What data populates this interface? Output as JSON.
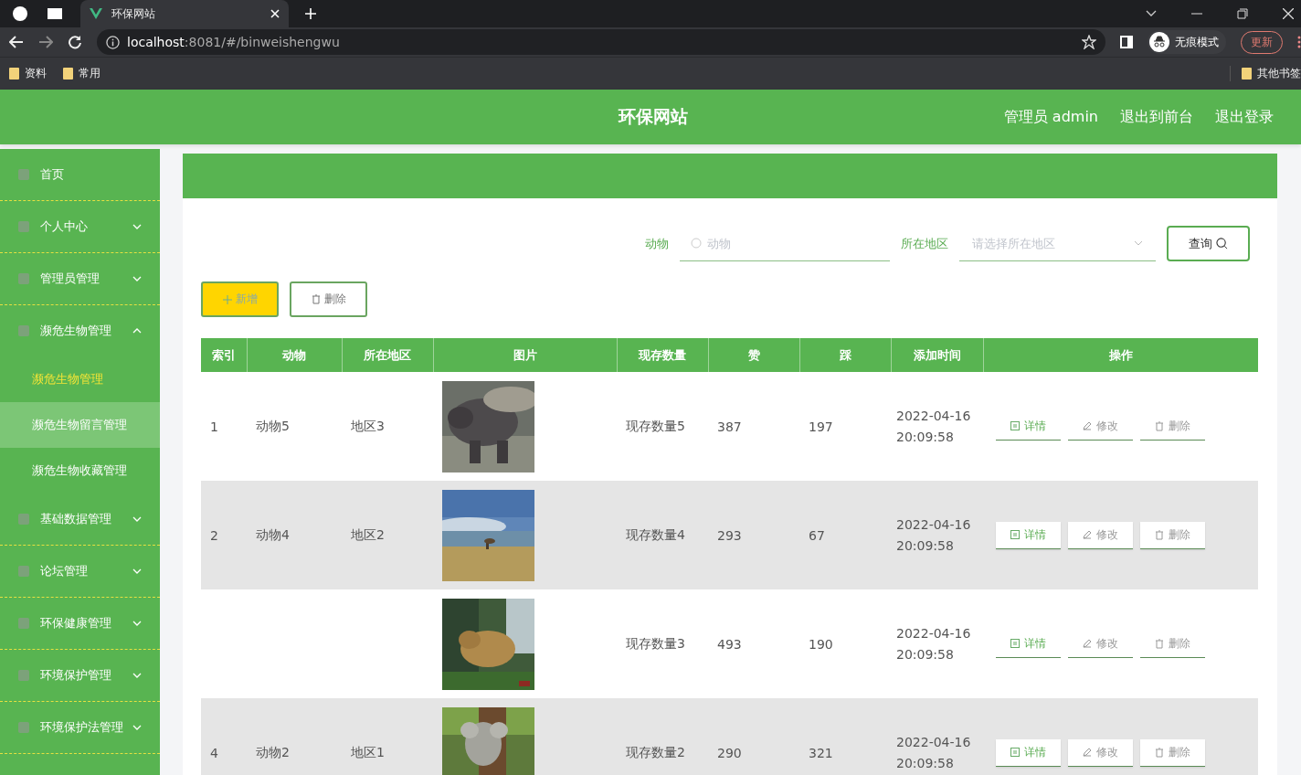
{
  "browser": {
    "tab_title": "环保网站",
    "url_host": "localhost",
    "url_rest": ":8081/#/binweishengwu",
    "incognito_label": "无痕模式",
    "update_button": "更新",
    "bookmarks": [
      "资料",
      "常用"
    ],
    "other_bookmarks": "其他书签"
  },
  "header": {
    "title": "环保网站",
    "links": [
      "管理员 admin",
      "退出到前台",
      "退出登录"
    ]
  },
  "sidebar": {
    "items": [
      {
        "label": "首页"
      },
      {
        "label": "个人中心",
        "expanded": false
      },
      {
        "label": "管理员管理",
        "expanded": false
      },
      {
        "label": "濒危生物管理",
        "expanded": true,
        "children": [
          {
            "label": "濒危生物管理",
            "selected": true,
            "hovered": false
          },
          {
            "label": "濒危生物留言管理",
            "selected": false,
            "hovered": true
          },
          {
            "label": "濒危生物收藏管理",
            "selected": false,
            "hovered": false
          }
        ]
      },
      {
        "label": "基础数据管理",
        "expanded": false
      },
      {
        "label": "论坛管理",
        "expanded": false
      },
      {
        "label": "环保健康管理",
        "expanded": false
      },
      {
        "label": "环境保护管理",
        "expanded": false
      },
      {
        "label": "环境保护法管理",
        "expanded": false
      }
    ]
  },
  "search": {
    "fields": [
      {
        "label": "动物",
        "placeholder": "动物",
        "kind": "text"
      },
      {
        "label": "所在地区",
        "placeholder": "请选择所在地区",
        "kind": "select"
      }
    ],
    "query_button": "查询"
  },
  "toolbar": {
    "add_button": "新增",
    "delete_button": "删除"
  },
  "table": {
    "columns": [
      "索引",
      "动物",
      "所在地区",
      "图片",
      "现存数量",
      "赞",
      "踩",
      "添加时间",
      "操作"
    ],
    "rows": [
      {
        "index": "1",
        "animal": "动物5",
        "region": "地区3",
        "stock": "现存数量5",
        "likes": "387",
        "dislikes": "197",
        "date": "2022-04-16",
        "time": "20:09:58",
        "actions": [
          "详情",
          "修改",
          "删除"
        ]
      },
      {
        "index": "2",
        "animal": "动物4",
        "region": "地区2",
        "stock": "现存数量4",
        "likes": "293",
        "dislikes": "67",
        "date": "2022-04-16",
        "time": "20:09:58",
        "actions": [
          "详情",
          "修改",
          "删除"
        ]
      },
      {
        "stock": "现存数量3",
        "likes": "493",
        "dislikes": "190",
        "date": "2022-04-16",
        "time": "20:09:58",
        "actions": [
          "详情",
          "修改",
          "删除"
        ]
      },
      {
        "index": "4",
        "animal": "动物2",
        "region": "地区1",
        "stock": "现存数量2",
        "likes": "290",
        "dislikes": "321",
        "date": "2022-04-16",
        "time": "20:09:58",
        "actions": [
          "详情",
          "修改",
          "删除"
        ]
      }
    ]
  }
}
